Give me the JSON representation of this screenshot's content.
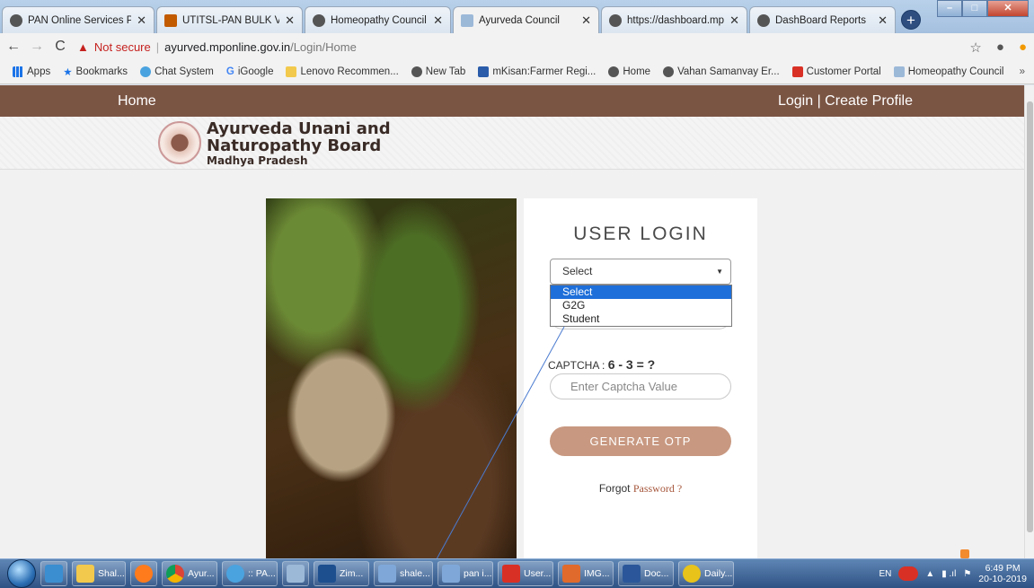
{
  "browser": {
    "tabs": [
      {
        "label": "PAN Online Services Por",
        "icon": "globe-icon",
        "active": false
      },
      {
        "label": "UTITSL-PAN BULK VERIF",
        "icon": "chart-icon",
        "active": false
      },
      {
        "label": "Homeopathy Council",
        "icon": "globe-icon",
        "active": false
      },
      {
        "label": "Ayurveda Council",
        "icon": "doc-icon",
        "active": true
      },
      {
        "label": "https://dashboard.mpon",
        "icon": "globe-icon",
        "active": false
      },
      {
        "label": "DashBoard Reports",
        "icon": "globe-icon",
        "active": false
      }
    ],
    "not_secure": "Not secure",
    "url_host": "ayurved.mponline.gov.in",
    "url_path": "/Login/Home",
    "bookmarks": [
      "Apps",
      "Bookmarks",
      "Chat System",
      "iGoogle",
      "Lenovo Recommen...",
      "New Tab",
      "mKisan:Farmer Regi...",
      "Home",
      "Vahan Samanvay Er...",
      "Customer Portal",
      "Homeopathy Council"
    ],
    "bookmarks_more": "»"
  },
  "site": {
    "nav_home": "Home",
    "nav_login": "Login | Create Profile",
    "brand_line1": "Ayurveda Unani and",
    "brand_line2": "Naturopathy Board",
    "brand_line3": "Madhya Pradesh"
  },
  "login": {
    "title": "USER LOGIN",
    "select_value": "Select",
    "options": [
      "Select",
      "G2G",
      "Student"
    ],
    "captcha_label": "CAPTCHA :",
    "captcha_question": "6 - 3 = ?",
    "captcha_placeholder": "Enter Captcha Value",
    "otp_button": "GENERATE OTP",
    "forgot_text": "Forgot",
    "forgot_link": "Password ?"
  },
  "taskbar": {
    "items": [
      "Shal...",
      "",
      "Ayur...",
      ":: PA...",
      "",
      "Zim...",
      "shale...",
      "pan i...",
      "User...",
      "IMG...",
      "Doc...",
      "Daily..."
    ],
    "lang": "EN",
    "time": "6:49 PM",
    "date": "20-10-2019"
  }
}
